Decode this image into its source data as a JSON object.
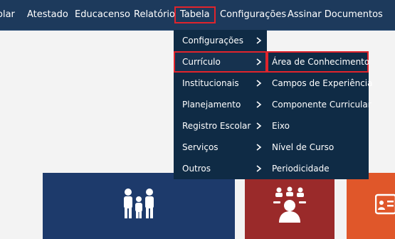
{
  "topnav": {
    "items": [
      {
        "label": "olar"
      },
      {
        "label": "Atestado"
      },
      {
        "label": "Educacenso"
      },
      {
        "label": "Relatório"
      },
      {
        "label": "Tabela"
      },
      {
        "label": "Configurações"
      },
      {
        "label": "Assinar Documentos"
      }
    ]
  },
  "menu_tabela": {
    "items": [
      {
        "label": "Configurações"
      },
      {
        "label": "Currículo"
      },
      {
        "label": "Institucionais"
      },
      {
        "label": "Planejamento"
      },
      {
        "label": "Registro Escolar"
      },
      {
        "label": "Serviços"
      },
      {
        "label": "Outros"
      }
    ]
  },
  "submenu_curriculo": {
    "items": [
      {
        "label": "Área de Conhecimento"
      },
      {
        "label": "Campos de Experiência"
      },
      {
        "label": "Componente Curricular"
      },
      {
        "label": "Eixo"
      },
      {
        "label": "Nível de Curso"
      },
      {
        "label": "Periodicidade"
      }
    ]
  },
  "tiles": [
    {
      "icon": "family-icon",
      "color": "#1d3a6b"
    },
    {
      "icon": "student-group-icon",
      "color": "#9a2a2a"
    },
    {
      "icon": "id-card-icon",
      "color": "#e0572a"
    }
  ],
  "colors": {
    "topbar": "#1d3a5c",
    "menu": "#0f2b45",
    "highlight": "#e0242c"
  }
}
